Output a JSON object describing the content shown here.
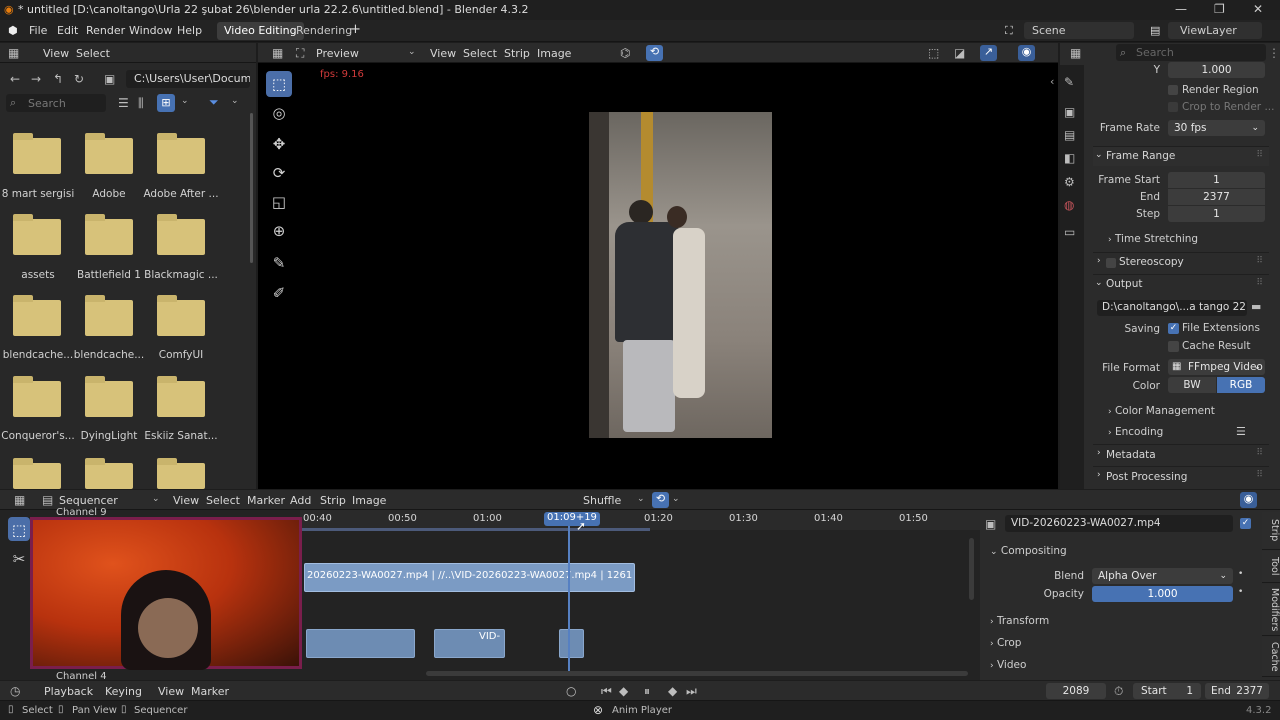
{
  "window": {
    "title": "* untitled [D:\\canoltango\\Urla 22 şubat 26\\blender urla 22.2.6\\untitled.blend] - Blender 4.3.2"
  },
  "menus": [
    "File",
    "Edit",
    "Render",
    "Window",
    "Help"
  ],
  "workspaces": [
    "Video Editing",
    "Rendering"
  ],
  "scene": {
    "scene": "Scene",
    "view_layer": "ViewLayer"
  },
  "file_browser": {
    "menus": [
      "View",
      "Select"
    ],
    "path": "C:\\Users\\User\\Docume...",
    "search_placeholder": "Search",
    "folders": [
      "8 mart sergisi",
      "Adobe",
      "Adobe After ...",
      "assets",
      "Battlefield 1",
      "Blackmagic ...",
      "blendcache...",
      "blendcache...",
      "ComfyUI",
      "Conqueror's...",
      "DyingLight",
      "Eskiiz Sanat..."
    ]
  },
  "preview": {
    "mode": "Preview",
    "menus": [
      "View",
      "Select",
      "Strip",
      "Image"
    ],
    "fps": "fps: 9.16"
  },
  "properties": {
    "search_placeholder": "Search",
    "y_label": "Y",
    "y_value": "1.000",
    "render_region": "Render Region",
    "crop_to_render": "Crop to Render ...",
    "frame_rate_label": "Frame Rate",
    "frame_rate": "30 fps",
    "frame_range": "Frame Range",
    "frame_start_label": "Frame Start",
    "frame_start": "1",
    "end_label": "End",
    "end": "2377",
    "step_label": "Step",
    "step": "1",
    "time_stretching": "Time Stretching",
    "stereoscopy": "Stereoscopy",
    "output": "Output",
    "output_path": "D:\\canoltango\\...a tango 22.2.26",
    "saving_label": "Saving",
    "file_extensions": "File Extensions",
    "cache_result": "Cache Result",
    "file_format_label": "File Format",
    "file_format": "FFmpeg Video",
    "color_label": "Color",
    "bw": "BW",
    "rgb": "RGB",
    "color_management": "Color Management",
    "encoding": "Encoding",
    "metadata": "Metadata",
    "post_processing": "Post Processing"
  },
  "sequencer": {
    "mode": "Sequencer",
    "menus": [
      "View",
      "Select",
      "Marker",
      "Add",
      "Strip",
      "Image"
    ],
    "shuffle": "Shuffle",
    "channel_top": "Channel 9",
    "channel_bottom": "Channel 4",
    "ticks": [
      "00:40",
      "00:50",
      "01:00",
      "01:09+19",
      "01:20",
      "01:30",
      "01:40",
      "01:50"
    ],
    "strip_label": "20260223-WA0027.mp4 | //..\\VID-20260223-WA0027.mp4 | 1261",
    "small_clip_label": "VID-"
  },
  "strip_props": {
    "name": "VID-20260223-WA0027.mp4",
    "compositing": "Compositing",
    "blend_label": "Blend",
    "blend": "Alpha Over",
    "opacity_label": "Opacity",
    "opacity": "1.000",
    "transform": "Transform",
    "crop": "Crop",
    "video": "Video",
    "tabs": [
      "Strip",
      "Tool",
      "Modifiers",
      "Cache"
    ]
  },
  "timeline": {
    "menus": [
      "Playback",
      "Keying",
      "View",
      "Marker"
    ],
    "frame": "2089",
    "start_label": "Start",
    "start": "1",
    "end_label": "End",
    "end": "2377"
  },
  "status": {
    "select": "Select",
    "pan_view": "Pan View",
    "sequencer": "Sequencer",
    "anim_player": "Anim Player",
    "version": "4.3.2"
  },
  "colors": {
    "accent": "#4772b3",
    "strip": "#6d8cb3",
    "playhead": "#5680c2"
  }
}
